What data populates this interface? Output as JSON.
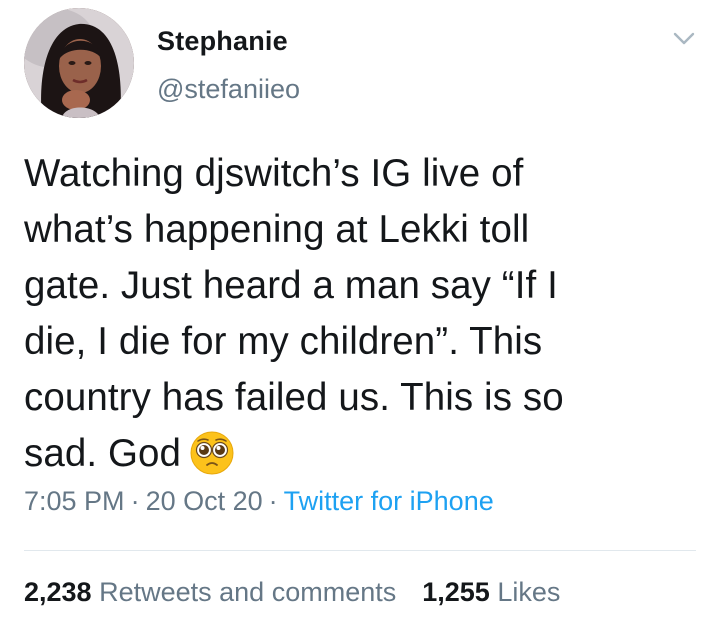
{
  "user": {
    "display_name": "Stephanie",
    "handle": "@stefaniieo"
  },
  "tweet": {
    "text_lines": [
      "Watching djswitch’s IG live of",
      "what’s happening at Lekki toll",
      "gate. Just heard a man say “If I",
      "die, I die for my children”. This",
      "country has failed us. This is so",
      "sad. God"
    ],
    "emoji": "pleading-face-emoji",
    "time": "7:05 PM",
    "date": "20 Oct 20",
    "separator": "·",
    "source": "Twitter for iPhone"
  },
  "stats": {
    "retweets_count": "2,238",
    "retweets_label": "Retweets and comments",
    "likes_count": "1,255",
    "likes_label": "Likes"
  },
  "icons": {
    "menu": "chevron-down-icon",
    "avatar": "profile-photo"
  },
  "colors": {
    "text": "#14171a",
    "secondary": "#657786",
    "link": "#1da1f2",
    "divider": "#e1e8ed",
    "background": "#ffffff"
  }
}
